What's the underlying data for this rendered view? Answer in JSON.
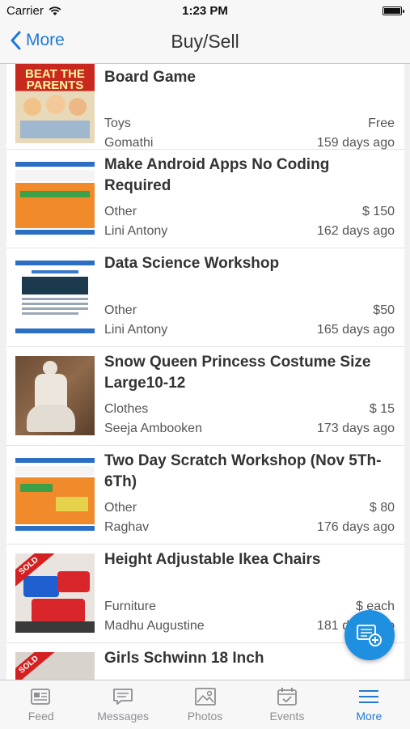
{
  "status": {
    "carrier": "Carrier",
    "time": "1:23 PM"
  },
  "nav": {
    "back_label": "More",
    "title": "Buy/Sell"
  },
  "items": [
    {
      "title": "Board Game",
      "category": "Toys",
      "price": "Free",
      "seller": "Gomathi",
      "age": "159 days ago",
      "thumb_text": "BEAT THE PARENTS"
    },
    {
      "title": "Make Android Apps No Coding Required",
      "category": "Other",
      "price": "$ 150",
      "seller": "Lini Antony",
      "age": "162 days ago"
    },
    {
      "title": "Data Science Workshop",
      "category": "Other",
      "price": "$50",
      "seller": "Lini Antony",
      "age": "165 days ago"
    },
    {
      "title": "Snow Queen Princess Costume Size Large10-12",
      "category": "Clothes",
      "price": "$ 15",
      "seller": "Seeja Ambooken",
      "age": "173 days ago"
    },
    {
      "title": "Two Day Scratch Workshop (Nov 5Th-6Th)",
      "category": "Other",
      "price": "$ 80",
      "seller": "Raghav",
      "age": "176 days ago"
    },
    {
      "title": "Height Adjustable Ikea Chairs",
      "category": "Furniture",
      "price": "$ each",
      "seller": "Madhu Augustine",
      "age": "181 days ago",
      "sold_label": "SOLD"
    },
    {
      "title": "Girls Schwinn 18 Inch",
      "sold_label": "SOLD"
    }
  ],
  "tabs": [
    {
      "label": "Feed"
    },
    {
      "label": "Messages"
    },
    {
      "label": "Photos"
    },
    {
      "label": "Events"
    },
    {
      "label": "More"
    }
  ],
  "colors": {
    "accent": "#1e7ad6",
    "fab": "#1f8fe0",
    "sold": "#d42020"
  }
}
